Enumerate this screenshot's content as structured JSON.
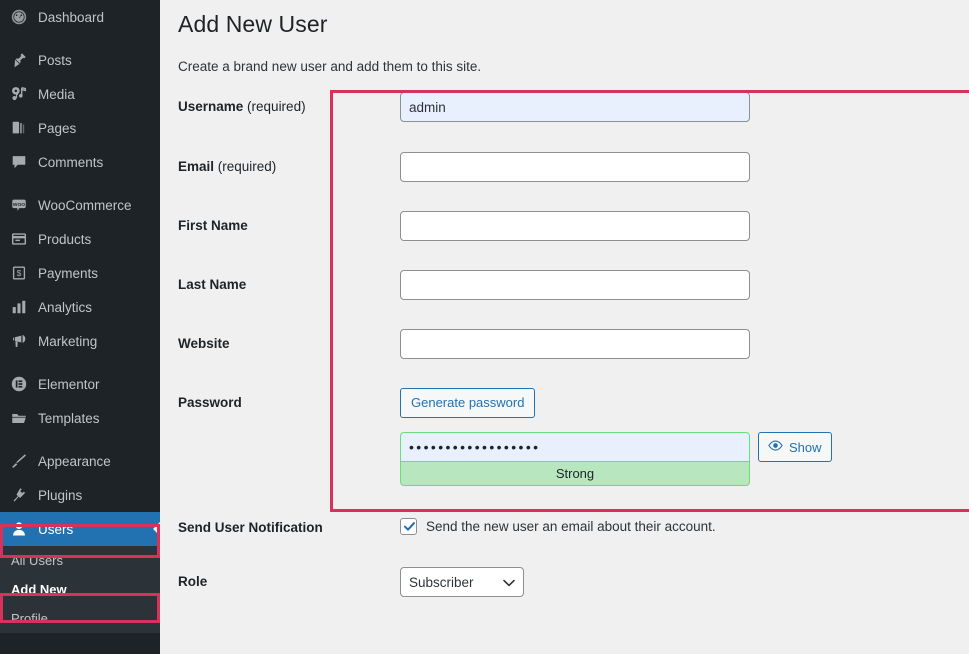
{
  "sidebar": {
    "items": [
      {
        "label": "Dashboard",
        "icon": "dashboard-icon",
        "current": false,
        "sep_after": true
      },
      {
        "label": "Posts",
        "icon": "pin-icon",
        "current": false,
        "sep_after": false
      },
      {
        "label": "Media",
        "icon": "media-icon",
        "current": false,
        "sep_after": false
      },
      {
        "label": "Pages",
        "icon": "pages-icon",
        "current": false,
        "sep_after": false
      },
      {
        "label": "Comments",
        "icon": "comments-icon",
        "current": false,
        "sep_after": true
      },
      {
        "label": "WooCommerce",
        "icon": "woocommerce-icon",
        "current": false,
        "sep_after": false
      },
      {
        "label": "Products",
        "icon": "products-icon",
        "current": false,
        "sep_after": false
      },
      {
        "label": "Payments",
        "icon": "payments-icon",
        "current": false,
        "sep_after": false
      },
      {
        "label": "Analytics",
        "icon": "analytics-icon",
        "current": false,
        "sep_after": false
      },
      {
        "label": "Marketing",
        "icon": "marketing-icon",
        "current": false,
        "sep_after": true
      },
      {
        "label": "Elementor",
        "icon": "elementor-icon",
        "current": false,
        "sep_after": false
      },
      {
        "label": "Templates",
        "icon": "templates-icon",
        "current": false,
        "sep_after": true
      },
      {
        "label": "Appearance",
        "icon": "appearance-icon",
        "current": false,
        "sep_after": false
      },
      {
        "label": "Plugins",
        "icon": "plugins-icon",
        "current": false,
        "sep_after": false
      },
      {
        "label": "Users",
        "icon": "users-icon",
        "current": true,
        "sep_after": false
      }
    ],
    "submenu": [
      {
        "label": "All Users",
        "current": false
      },
      {
        "label": "Add New",
        "current": true
      },
      {
        "label": "Profile",
        "current": false
      }
    ],
    "colors": {
      "background": "#1d2327",
      "submenu_background": "#2c3338",
      "current": "#2271b1",
      "highlight": "#d6325b"
    }
  },
  "main": {
    "title": "Add New User",
    "subtitle": "Create a brand new user and add them to this site.",
    "fields": {
      "username": {
        "label": "Username",
        "required_suffix": " (required)",
        "value": "admin",
        "placeholder": ""
      },
      "email": {
        "label": "Email",
        "required_suffix": " (required)",
        "value": "",
        "placeholder": ""
      },
      "first_name": {
        "label": "First Name",
        "required_suffix": "",
        "value": "",
        "placeholder": ""
      },
      "last_name": {
        "label": "Last Name",
        "required_suffix": "",
        "value": "",
        "placeholder": ""
      },
      "website": {
        "label": "Website",
        "required_suffix": "",
        "value": "",
        "placeholder": ""
      },
      "password": {
        "label": "Password",
        "generate_label": "Generate password",
        "value": "••••••••••••••••••",
        "strength_label": "Strong",
        "show_label": "Show",
        "strength_color": "#b8e6bf",
        "border_color": "#68de7c"
      },
      "send_notification": {
        "label": "Send User Notification",
        "checkbox_label": "Send the new user an email about their account.",
        "checked": true
      },
      "role": {
        "label": "Role",
        "selected": "Subscriber"
      }
    }
  }
}
